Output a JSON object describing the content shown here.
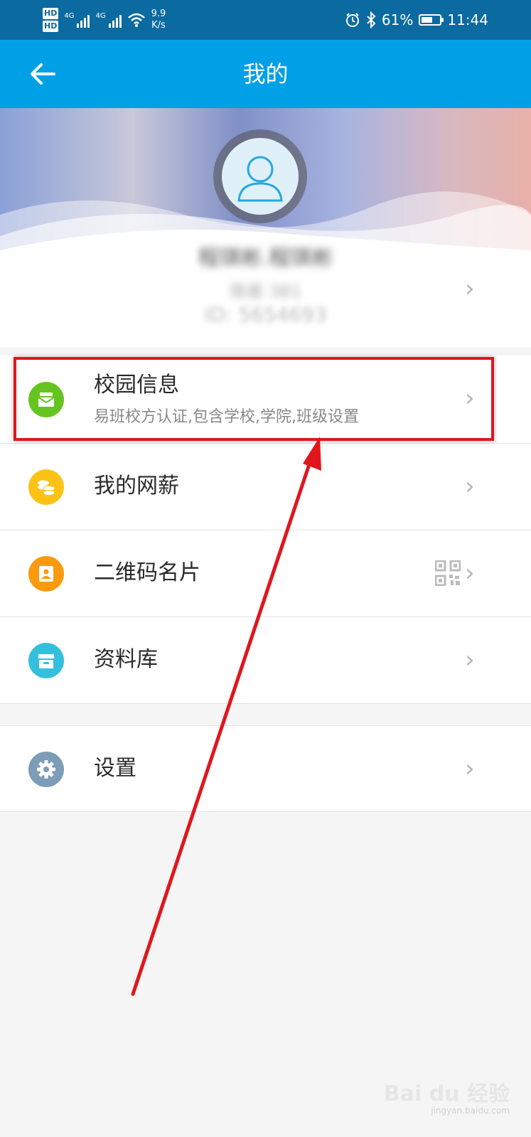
{
  "status_bar": {
    "hd1": "HD",
    "hd2": "HD",
    "signal1": "4G",
    "signal2": "4G",
    "net_speed_value": "9.9",
    "net_speed_unit": "K/s",
    "battery_text": "61%",
    "battery_level": 0.61,
    "time": "11:44"
  },
  "header": {
    "title": "我的"
  },
  "profile": {
    "name": "程琪彬.程琪彬",
    "nickname": "简易 381",
    "id": "ID: 5654693"
  },
  "menu": [
    {
      "label": "校园信息",
      "sub": "易班校方认证,包含学校,学院,班级设置",
      "icon": "mailbox-icon",
      "color": "#66c421"
    },
    {
      "label": "我的网薪",
      "icon": "coins-icon",
      "color": "#fcc316"
    },
    {
      "label": "二维码名片",
      "icon": "contact-card-icon",
      "color": "#fb9a0e"
    },
    {
      "label": "资料库",
      "icon": "archive-box-icon",
      "color": "#34c0dd"
    },
    {
      "label": "设置",
      "icon": "gear-icon",
      "color": "#7d9cb8"
    }
  ],
  "watermark": {
    "text": "Bai du 经验",
    "url": "jingyan.baidu.com"
  }
}
